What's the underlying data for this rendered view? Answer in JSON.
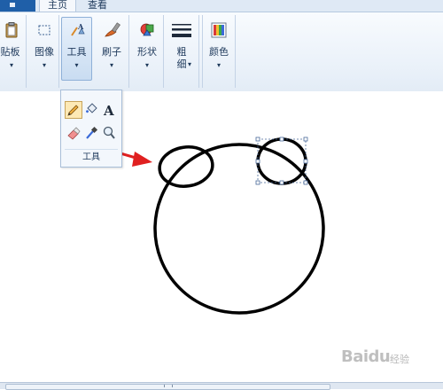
{
  "tabs": {
    "home_label": "主页",
    "view_label": "查看"
  },
  "ribbon": {
    "clipboard_label": "剪贴板",
    "image_label": "图像",
    "tools_label": "工具",
    "brushes_label": "刷子",
    "shapes_label": "形状",
    "size_label_1": "粗",
    "size_label_2": "细",
    "colors_label": "颜色",
    "dropdown_glyph": "▾"
  },
  "tools_popup": {
    "group_label": "工具",
    "selected_tool": "pencil",
    "tools": [
      "pencil-icon",
      "fill-icon",
      "text-icon",
      "eraser-icon",
      "color-picker-icon",
      "magnifier-icon"
    ],
    "text_tool_glyph": "A"
  },
  "canvas": {
    "shapes": [
      "big-circle",
      "left-ear-ellipse",
      "right-ear-ellipse-selected"
    ],
    "annotation_color": "#e02020"
  },
  "watermark": {
    "brand": "Baidu",
    "sub": "经验"
  },
  "colors": {
    "accent": "#1f5fa8",
    "ribbon_text": "#1e395b",
    "stroke": "#000000",
    "arrow": "#e02020"
  }
}
